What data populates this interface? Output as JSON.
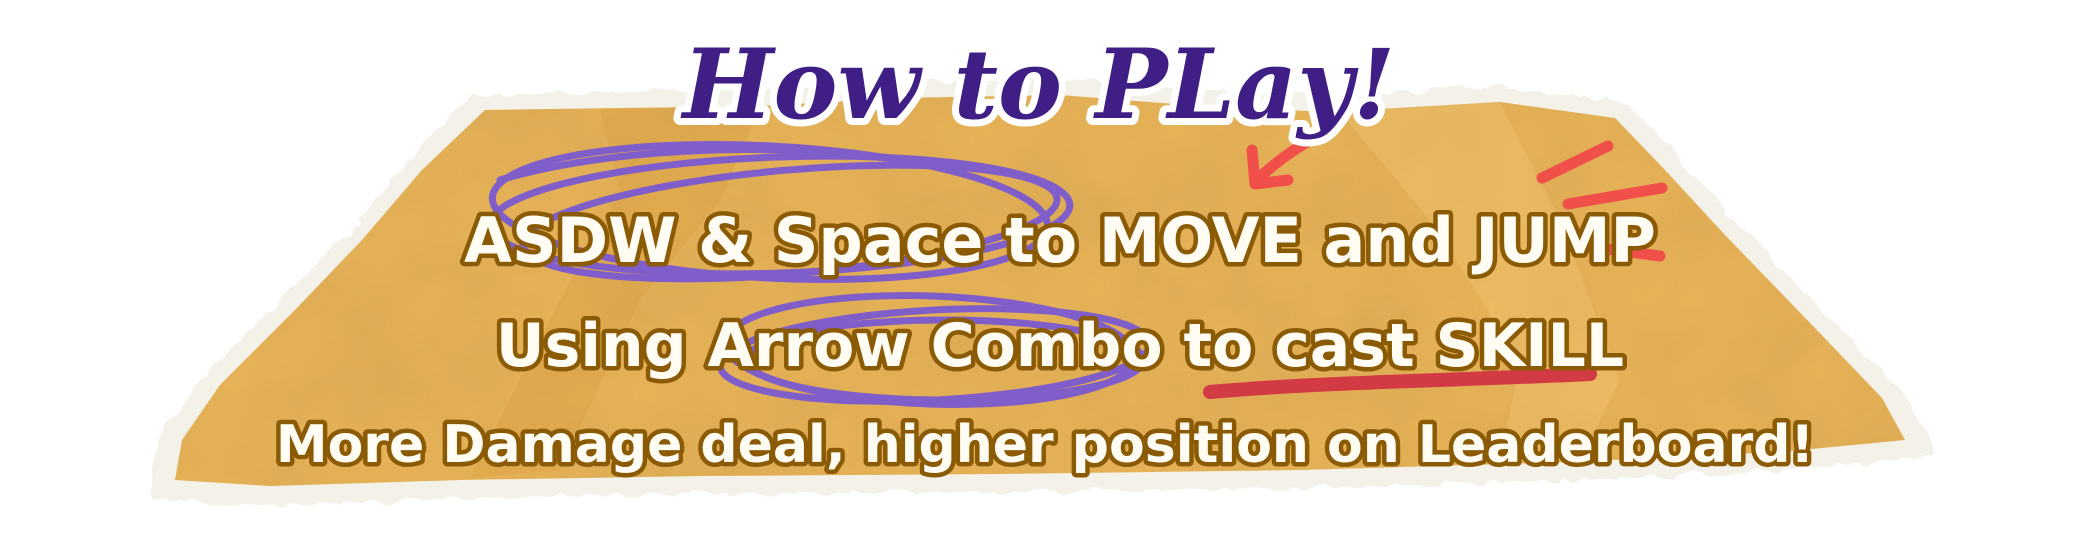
{
  "title": "How to PLay!",
  "instructions": {
    "line1": "ASDW & Space to MOVE and JUMP",
    "line2": "Using Arrow Combo to cast SKILL",
    "line3": "More Damage deal, higher position on Leaderboard!"
  },
  "colors": {
    "paper": "#e8b45a",
    "paper_dark": "#d89f3e",
    "paper_edge": "#f2efe6",
    "title_fill": "#3f1f86",
    "title_outline": "#ffffff",
    "text_fill": "#fffdf3",
    "text_outline": "#8a5a05",
    "scribble_purple": "#7b5ad1",
    "marker_red": "#f1504a",
    "underline_red": "#d23a44"
  }
}
